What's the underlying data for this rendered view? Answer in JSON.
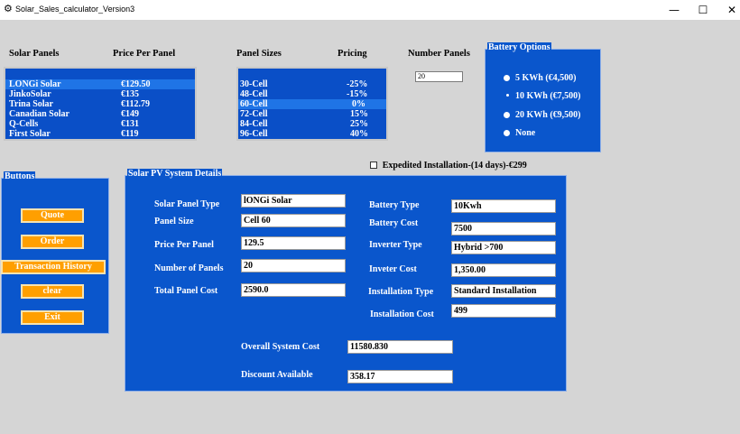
{
  "window": {
    "title": "Solar_Sales_calculator_Version3",
    "minimize": "—",
    "maximize": "☐",
    "close": "✕",
    "icon": "gear-icon"
  },
  "headers": {
    "solar_panels": "Solar Panels",
    "price_per_panel": "Price Per Panel",
    "panel_sizes": "Panel Sizes",
    "pricing": "Pricing",
    "number_panels": "Number Panels"
  },
  "panels": [
    {
      "name": "LONGi Solar",
      "price": "€129.50",
      "selected": true
    },
    {
      "name": "JinkoSolar",
      "price": "€135"
    },
    {
      "name": "Trina Solar",
      "price": "€112.79"
    },
    {
      "name": "Canadian Solar",
      "price": "€149"
    },
    {
      "name": "Q-Cells",
      "price": "€131"
    },
    {
      "name": "First Solar",
      "price": "€119"
    }
  ],
  "sizes": [
    {
      "name": "30-Cell",
      "pricing": "-25%"
    },
    {
      "name": "48-Cell",
      "pricing": "-15%"
    },
    {
      "name": "60-Cell",
      "pricing": "0%",
      "selected": true
    },
    {
      "name": "72-Cell",
      "pricing": "15%"
    },
    {
      "name": "84-Cell",
      "pricing": "25%"
    },
    {
      "name": "96-Cell",
      "pricing": "40%"
    }
  ],
  "number_panels_value": "20",
  "battery": {
    "legend": "Battery Options",
    "options": [
      {
        "label": "5 KWh (€4,500)"
      },
      {
        "label": "10 KWh (€7,500)",
        "selected": true
      },
      {
        "label": "20 KWh (€9,500)"
      },
      {
        "label": "None"
      }
    ]
  },
  "expedited_label": "Expedited Installation-(14 days)-€299",
  "buttons": {
    "legend": "Buttons",
    "quote": "Quote",
    "order": "Order",
    "history": "Transaction History",
    "clear": "clear",
    "exit": "Exit"
  },
  "details": {
    "legend": "Solar PV System Details",
    "panel_type_label": "Solar Panel Type",
    "panel_type": "lONGi Solar",
    "panel_size_label": "Panel Size",
    "panel_size": "Cell 60",
    "price_label": "Price Per Panel",
    "price": "129.5",
    "num_label": "Number of Panels",
    "num": "20",
    "total_label": "Total Panel Cost",
    "total": "2590.0",
    "battery_type_label": "Battery Type",
    "battery_type": "10Kwh",
    "battery_cost_label": "Battery Cost",
    "battery_cost": "7500",
    "inverter_type_label": "Inverter Type",
    "inverter_type": "Hybrid >700",
    "inverter_cost_label": "Inveter Cost",
    "inverter_cost": "1,350.00",
    "install_type_label": "Installation Type",
    "install_type": "Standard Installation",
    "install_cost_label": "Installation Cost",
    "install_cost": "499",
    "overall_label": "Overall System Cost",
    "overall": "11580.830",
    "discount_label": "Discount Available",
    "discount": "358.17"
  },
  "colors": {
    "frame_blue": "#0a56cc",
    "listbox_blue": "#0a4fc7",
    "selected_row": "#1f74e6",
    "button_orange": "#ff9f00"
  }
}
